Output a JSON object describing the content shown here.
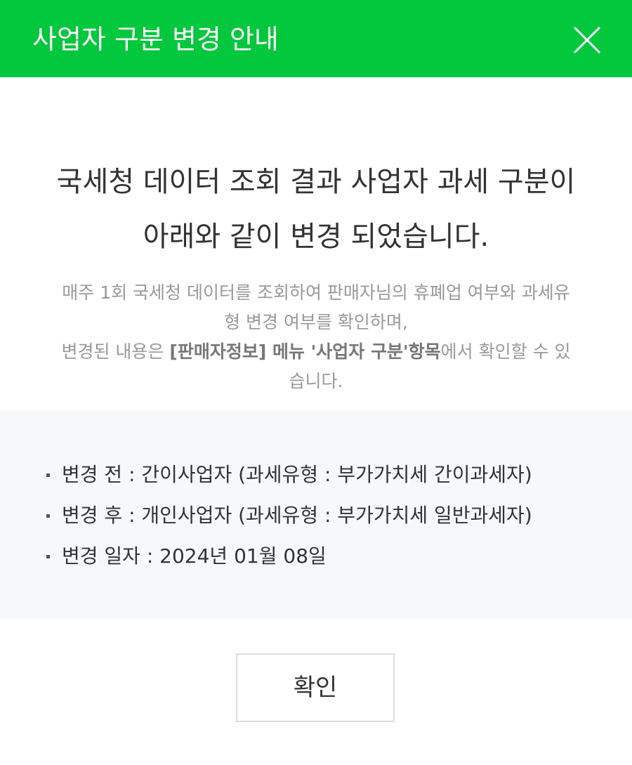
{
  "header": {
    "title": "사업자 구분 변경 안내",
    "close_icon": "close-icon"
  },
  "headline": {
    "line1": "국세청 데이터 조회 결과 사업자 과세 구분이",
    "line2": "아래와 같이 변경 되었습니다."
  },
  "description": {
    "line1": "매주 1회 국세청 데이터를 조회하여 판매자님의 휴폐업 여부와 과세유",
    "line2": "형 변경 여부를 확인하며,",
    "line3_prefix": "변경된 내용은 ",
    "line3_menu": "[판매자정보] 메뉴 '사업자 구분'항목",
    "line3_suffix": "에서 확인할 수 있",
    "line4": "습니다."
  },
  "info": {
    "items": [
      {
        "text": "변경 전 : 간이사업자 (과세유형 : 부가가치세 간이과세자)"
      },
      {
        "text": "변경 후 : 개인사업자 (과세유형 : 부가가치세 일반과세자)"
      },
      {
        "text": "변경 일자 : 2024년 01월 08일"
      }
    ]
  },
  "confirm_label": "확인",
  "colors": {
    "header_bg": "#03c73c",
    "info_bg": "#f7f8fb"
  }
}
